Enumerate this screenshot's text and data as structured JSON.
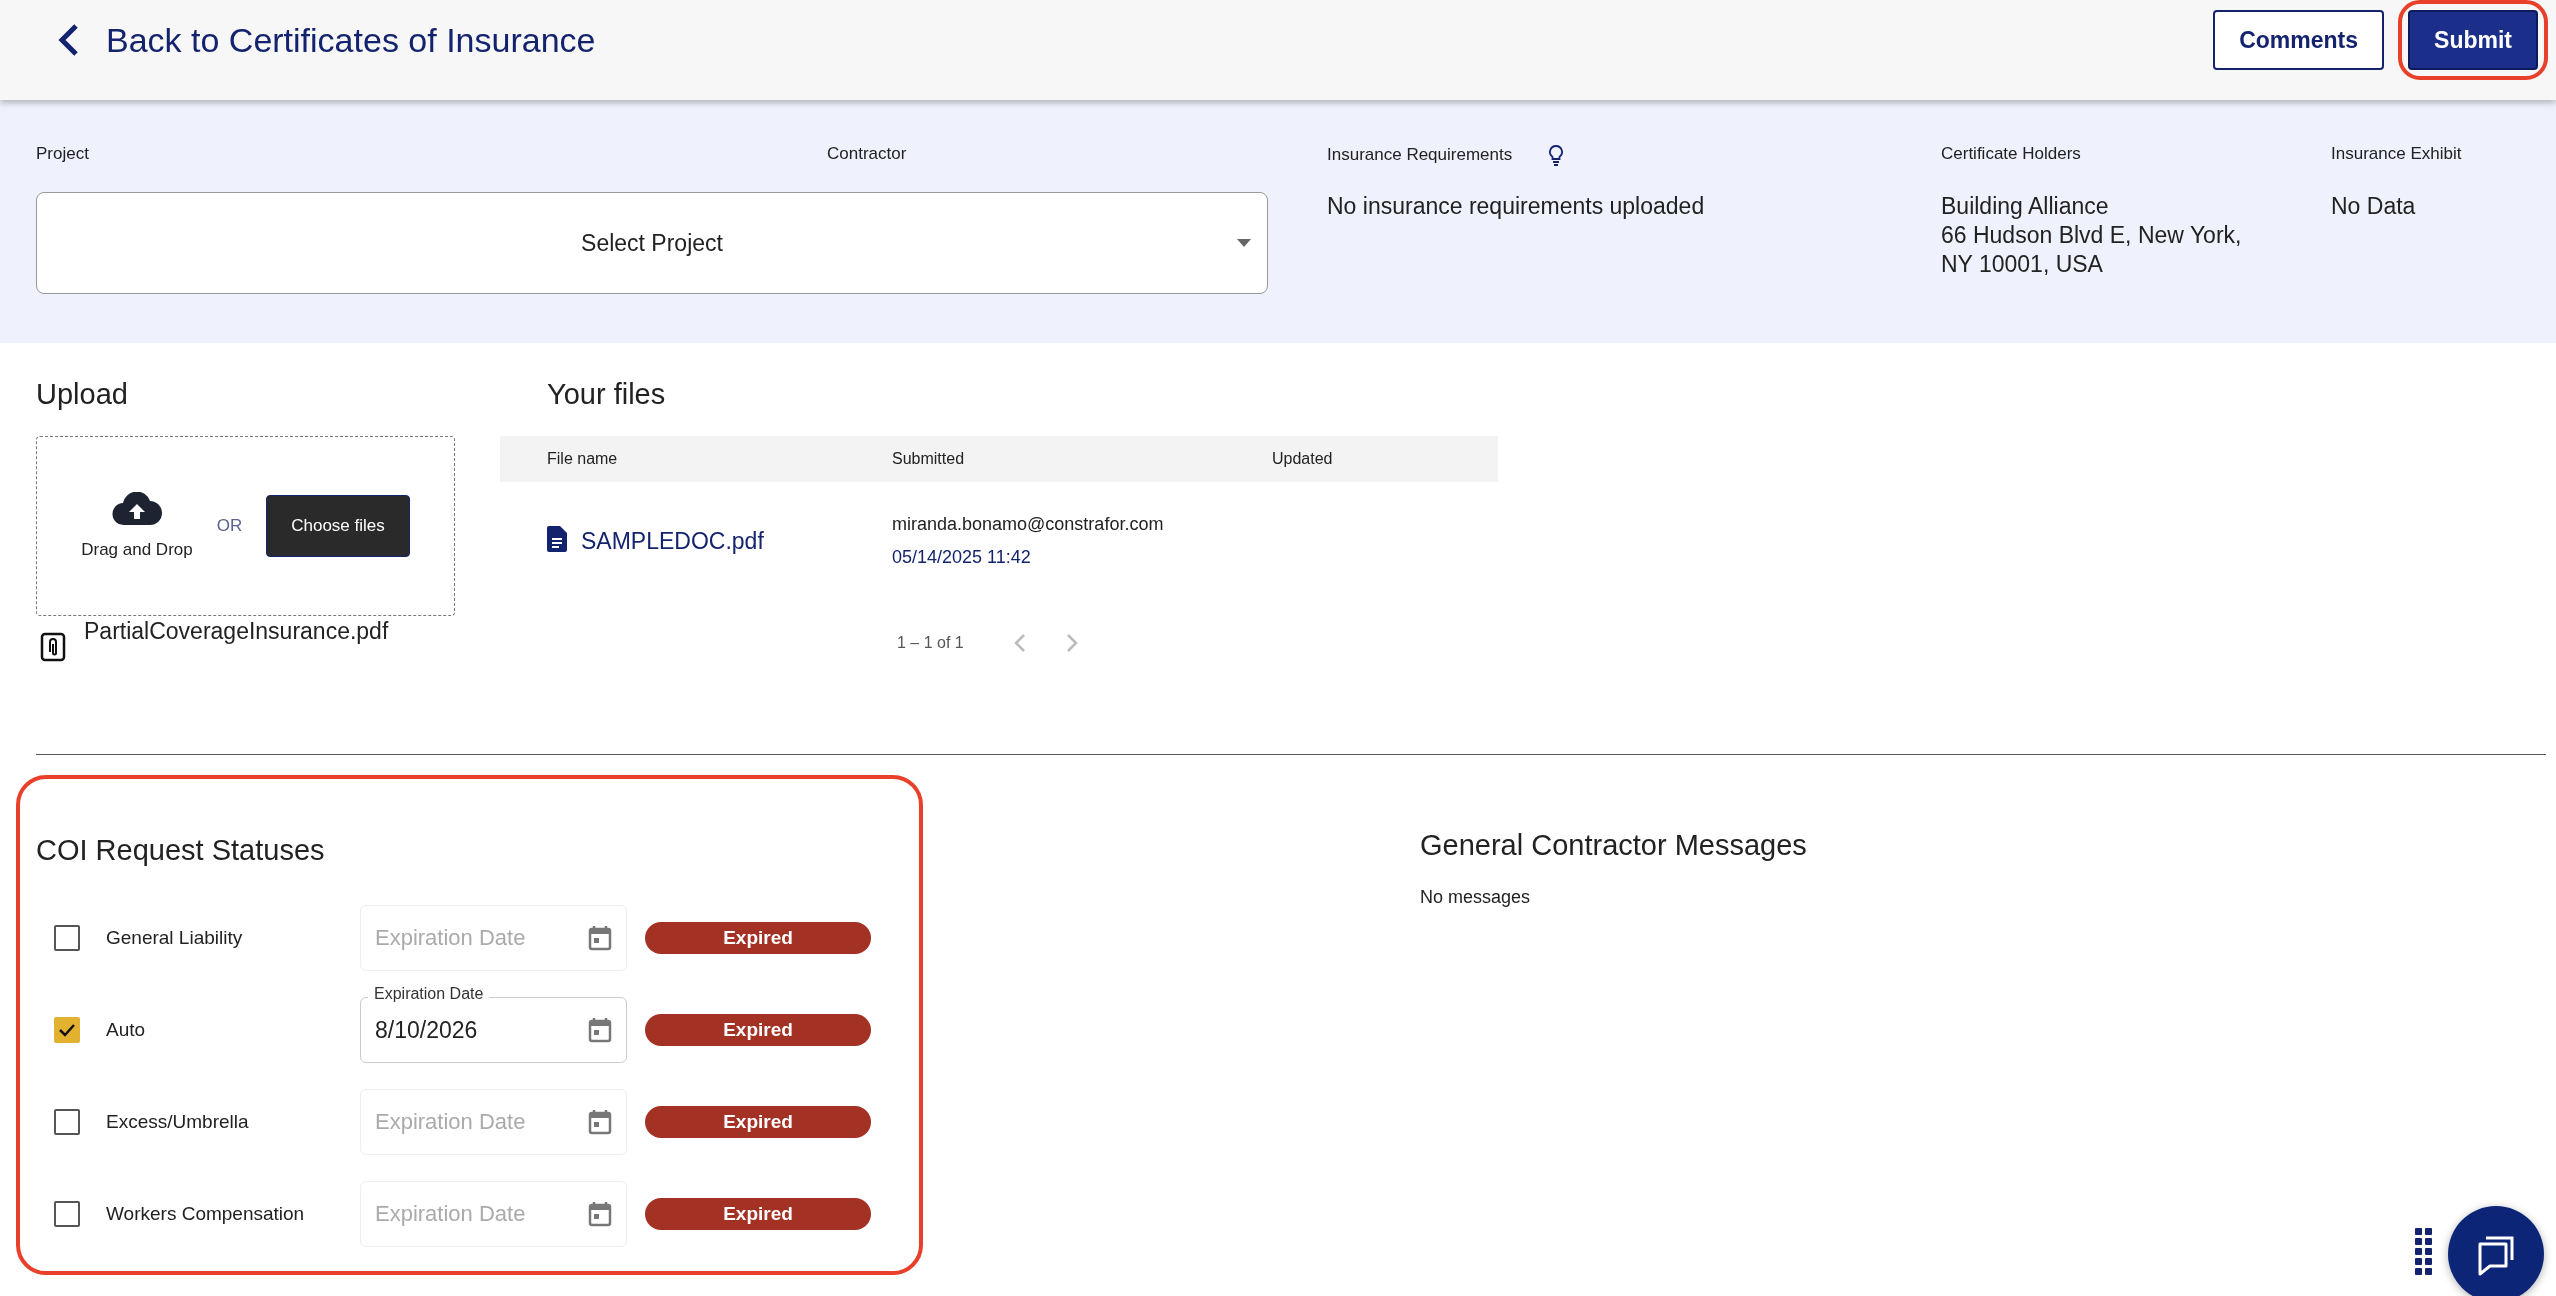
{
  "header": {
    "back_label": "Back to Certificates of Insurance",
    "buttons": [
      {
        "label": "Comments",
        "kind": "outline",
        "highlighted": false
      },
      {
        "label": "Submit",
        "kind": "primary",
        "highlighted": true
      }
    ]
  },
  "summary": {
    "project": {
      "label": "Project",
      "placeholder": "Select Project"
    },
    "contractor": {
      "label": "Contractor"
    },
    "insurance_requirements": {
      "label": "Insurance Requirements",
      "value": "No insurance requirements uploaded"
    },
    "certificate_holders": {
      "label": "Certificate Holders",
      "lines": [
        "Building Alliance",
        "66 Hudson Blvd E, New York,",
        "NY 10001, USA"
      ]
    },
    "insurance_exhibit": {
      "label": "Insurance Exhibit",
      "value": "No Data"
    }
  },
  "upload": {
    "title": "Upload",
    "drop_label": "Drag and Drop",
    "or_label": "OR",
    "button": "Choose files",
    "attached_file": "PartialCoverageInsurance.pdf"
  },
  "files": {
    "title": "Your files",
    "columns": [
      "File name",
      "Submitted",
      "Updated"
    ],
    "rows": [
      {
        "file_name": "SAMPLEDOC.pdf",
        "submitted_by": "miranda.bonamo@constrafor.com",
        "submitted_at": "05/14/2025 11:42"
      }
    ],
    "pagination": "1 – 1 of 1"
  },
  "coi_statuses": {
    "title": "COI Request Statuses",
    "highlighted": true,
    "rows": [
      {
        "name": "General Liability",
        "checked": false,
        "field": {
          "placeholder": "Expiration Date"
        },
        "status": "Expired"
      },
      {
        "name": "Auto",
        "checked": true,
        "field": {
          "label": "Expiration Date",
          "value": "8/10/2026"
        },
        "status": "Expired"
      },
      {
        "name": "Excess/Umbrella",
        "checked": false,
        "field": {
          "placeholder": "Expiration Date"
        },
        "status": "Expired"
      },
      {
        "name": "Workers Compensation",
        "checked": false,
        "field": {
          "placeholder": "Expiration Date"
        },
        "status": "Expired"
      }
    ]
  },
  "messages": {
    "title": "General Contractor Messages",
    "empty_text": "No messages"
  }
}
